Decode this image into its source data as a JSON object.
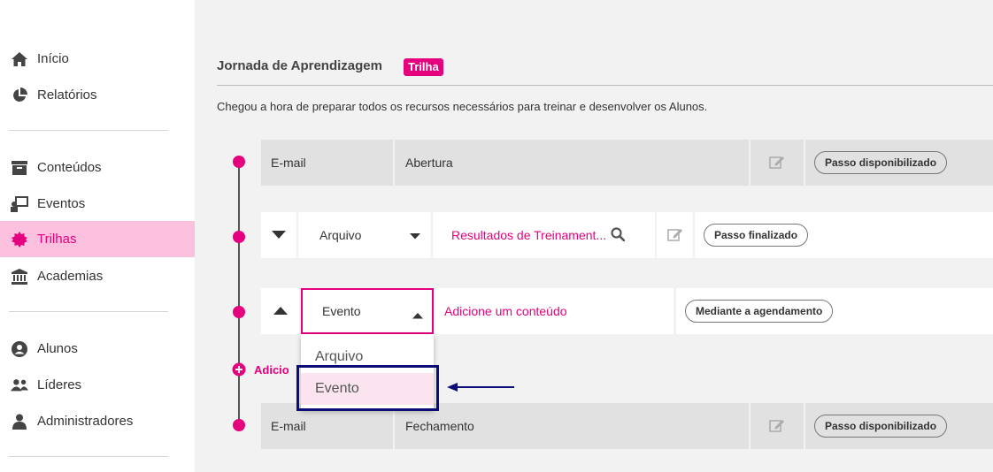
{
  "sidebar": {
    "items": [
      {
        "label": "Início",
        "icon": "home-icon"
      },
      {
        "label": "Relatórios",
        "icon": "pie-chart-icon"
      },
      {
        "label": "Conteúdos",
        "icon": "archive-icon"
      },
      {
        "label": "Eventos",
        "icon": "presentation-icon"
      },
      {
        "label": "Trilhas",
        "icon": "badge-icon",
        "active": true
      },
      {
        "label": "Academias",
        "icon": "institution-icon"
      },
      {
        "label": "Alunos",
        "icon": "user-circle-icon"
      },
      {
        "label": "Líderes",
        "icon": "users-icon"
      },
      {
        "label": "Administradores",
        "icon": "admin-icon"
      }
    ]
  },
  "header": {
    "title": "Jornada de Aprendizagem",
    "badge": "Trilha",
    "subtitle": "Chegou a hora de preparar todos os recursos necessários para treinar e desenvolver os Alunos."
  },
  "steps": {
    "opening": {
      "type": "E-mail",
      "name": "Abertura",
      "status": "Passo disponibilizado"
    },
    "file": {
      "type": "Arquivo",
      "content": "Resultados de Treinament...",
      "status": "Passo finalizado"
    },
    "event": {
      "type": "Evento",
      "content": "Adicione um conteúdo",
      "status": "Mediante a agendamento"
    },
    "closing": {
      "type": "E-mail",
      "name": "Fechamento",
      "status": "Passo disponibilizado"
    }
  },
  "dropdown": {
    "options": [
      "Arquivo",
      "Evento"
    ],
    "selected": "Evento"
  },
  "add_step_label": "Adicio",
  "colors": {
    "accent": "#e5007e",
    "active_bg": "#fbc0dd",
    "annotation": "#0d0d7a"
  }
}
